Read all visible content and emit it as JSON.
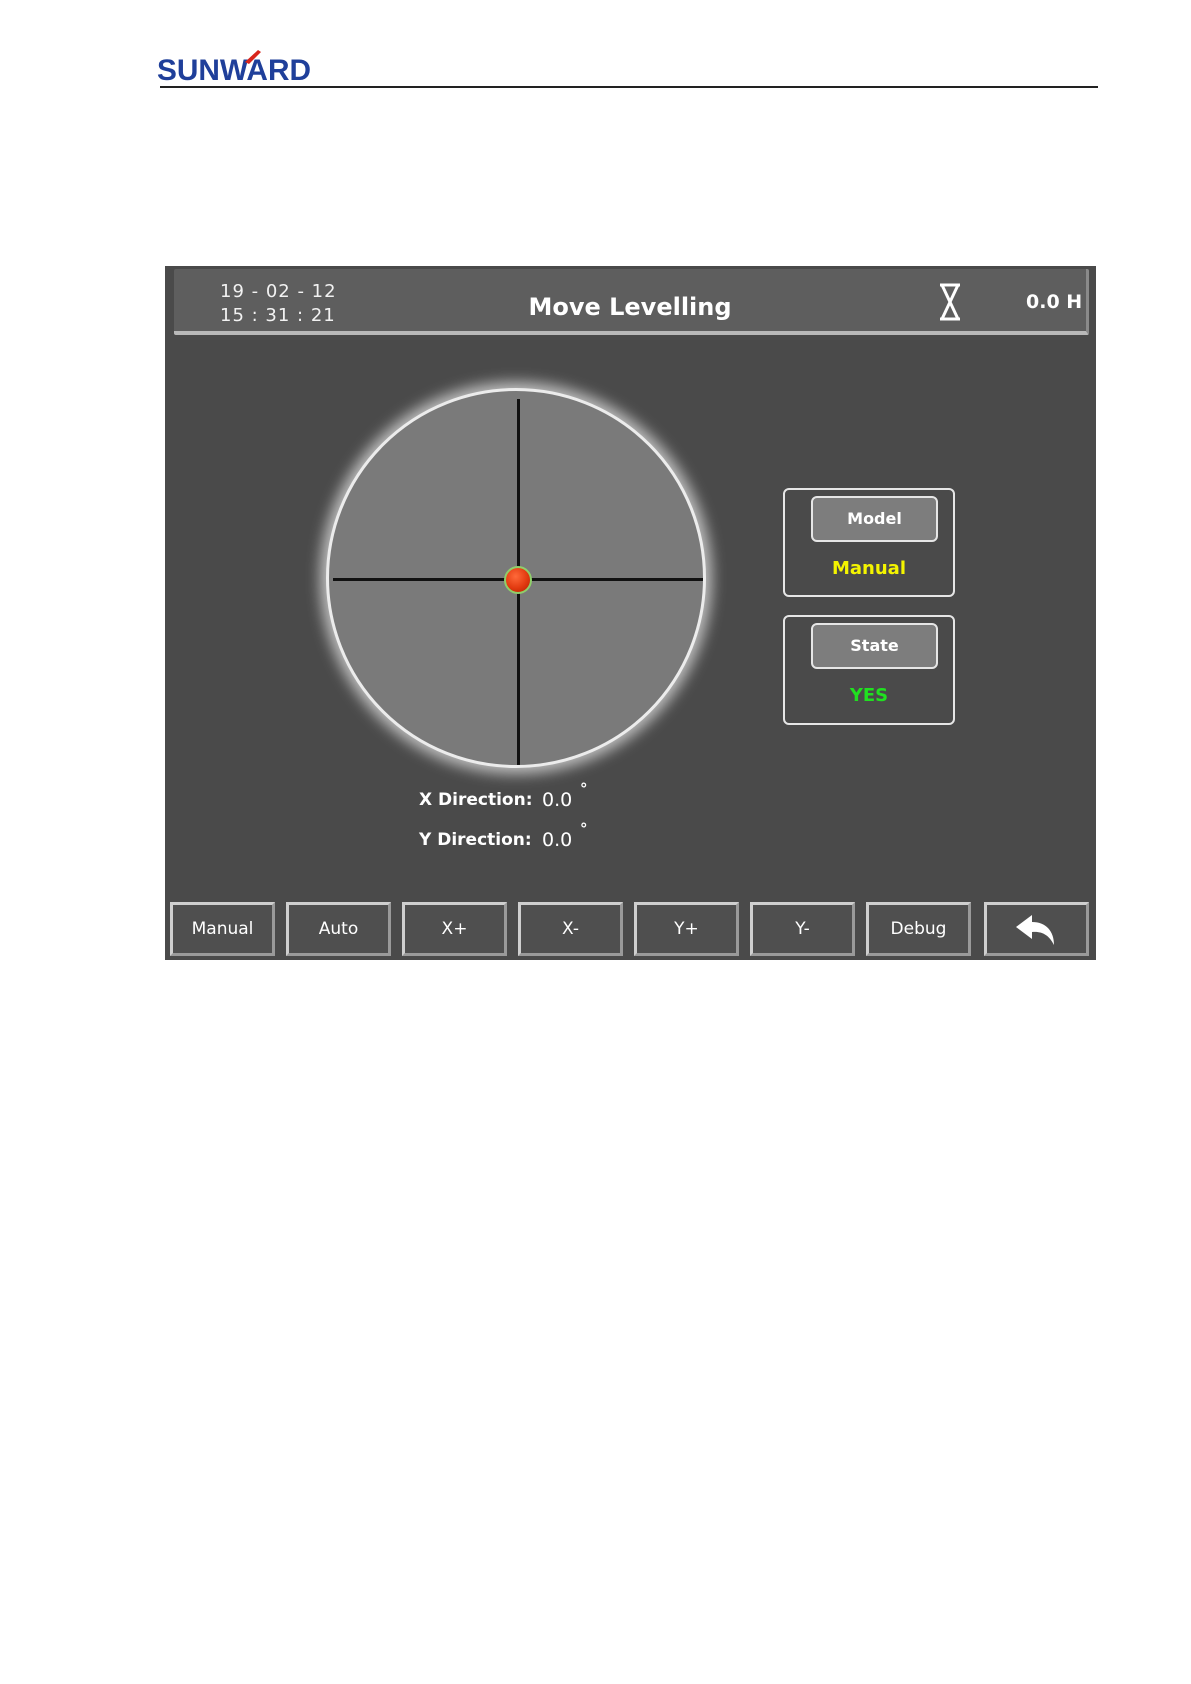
{
  "document": {
    "logo_text": "SUNWARD"
  },
  "topbar": {
    "date": "19 - 02 - 12",
    "time": "15 : 31 : 21",
    "title": "Move Levelling",
    "hours": "0.0 H"
  },
  "level": {
    "x_label": "X Direction:",
    "x_value": "0.0",
    "y_label": "Y Direction:",
    "y_value": "0.0",
    "unit": "°",
    "bubble_x_deg": 0.0,
    "bubble_y_deg": 0.0
  },
  "status": {
    "model_label": "Model",
    "model_value": "Manual",
    "state_label": "State",
    "state_value": "YES"
  },
  "buttons": [
    {
      "label": "Manual"
    },
    {
      "label": "Auto"
    },
    {
      "label": "X+"
    },
    {
      "label": "X-"
    },
    {
      "label": "Y+"
    },
    {
      "label": "Y-"
    },
    {
      "label": "Debug"
    },
    {
      "label": "",
      "icon": "back-arrow-icon"
    }
  ],
  "colors": {
    "model_value": "#f4f400",
    "state_value": "#20e020",
    "logo_blue": "#1f3f9a",
    "logo_red": "#d8251c"
  }
}
